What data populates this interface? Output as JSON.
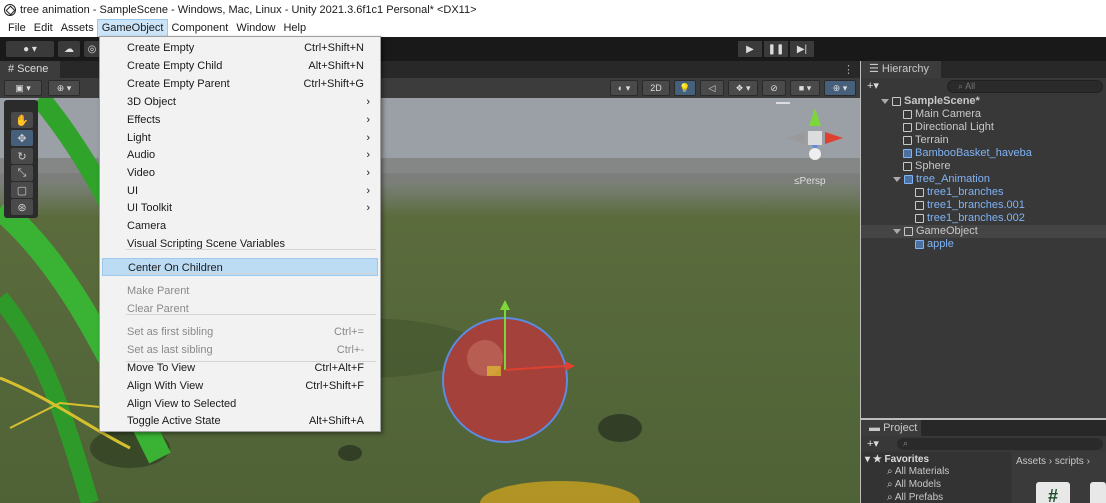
{
  "window": {
    "title": "tree animation - SampleScene - Windows, Mac, Linux - Unity 2021.3.6f1c1 Personal* <DX11>"
  },
  "menubar": [
    "File",
    "Edit",
    "Assets",
    "GameObject",
    "Component",
    "Window",
    "Help"
  ],
  "toolbar": {
    "play": "▶",
    "pause": "❚❚",
    "step": "▶|",
    "account": "☁"
  },
  "scene": {
    "tab_label": "# Scene",
    "persp_label": "≤Persp",
    "mode_2d": "2D"
  },
  "gameobject_menu": {
    "items": [
      {
        "label": "Create Empty",
        "shortcut": "Ctrl+Shift+N",
        "submenu": false,
        "disabled": false
      },
      {
        "label": "Create Empty Child",
        "shortcut": "Alt+Shift+N",
        "submenu": false,
        "disabled": false
      },
      {
        "label": "Create Empty Parent",
        "shortcut": "Ctrl+Shift+G",
        "submenu": false,
        "disabled": false
      },
      {
        "label": "3D Object",
        "shortcut": "",
        "submenu": true,
        "disabled": false
      },
      {
        "label": "Effects",
        "shortcut": "",
        "submenu": true,
        "disabled": false
      },
      {
        "label": "Light",
        "shortcut": "",
        "submenu": true,
        "disabled": false
      },
      {
        "label": "Audio",
        "shortcut": "",
        "submenu": true,
        "disabled": false
      },
      {
        "label": "Video",
        "shortcut": "",
        "submenu": true,
        "disabled": false
      },
      {
        "label": "UI",
        "shortcut": "",
        "submenu": true,
        "disabled": false
      },
      {
        "label": "UI Toolkit",
        "shortcut": "",
        "submenu": true,
        "disabled": false
      },
      {
        "label": "Camera",
        "shortcut": "",
        "submenu": false,
        "disabled": false
      },
      {
        "label": "Visual Scripting Scene Variables",
        "shortcut": "",
        "submenu": false,
        "disabled": false
      },
      {
        "label": "Center On Children",
        "shortcut": "",
        "submenu": false,
        "disabled": false,
        "highlighted": true
      },
      {
        "label": "Make Parent",
        "shortcut": "",
        "submenu": false,
        "disabled": true
      },
      {
        "label": "Clear Parent",
        "shortcut": "",
        "submenu": false,
        "disabled": true
      },
      {
        "label": "Set as first sibling",
        "shortcut": "Ctrl+=",
        "submenu": false,
        "disabled": true
      },
      {
        "label": "Set as last sibling",
        "shortcut": "Ctrl+-",
        "submenu": false,
        "disabled": true
      },
      {
        "label": "Move To View",
        "shortcut": "Ctrl+Alt+F",
        "submenu": false,
        "disabled": false
      },
      {
        "label": "Align With View",
        "shortcut": "Ctrl+Shift+F",
        "submenu": false,
        "disabled": false
      },
      {
        "label": "Align View to Selected",
        "shortcut": "",
        "submenu": false,
        "disabled": false
      },
      {
        "label": "Toggle Active State",
        "shortcut": "Alt+Shift+A",
        "submenu": false,
        "disabled": false
      }
    ],
    "arrow_glyph": "›"
  },
  "hierarchy": {
    "tab_label": "Hierarchy",
    "add_label": "+▾",
    "search_placeholder": "All",
    "rows": [
      {
        "label": "SampleScene*",
        "depth": 0,
        "expander": true,
        "icon": "unity-scene-icon",
        "blue": false
      },
      {
        "label": "Main Camera",
        "depth": 1,
        "expander": false,
        "icon": "gameobject-icon",
        "blue": false
      },
      {
        "label": "Directional Light",
        "depth": 1,
        "expander": false,
        "icon": "gameobject-icon",
        "blue": false
      },
      {
        "label": "Terrain",
        "depth": 1,
        "expander": false,
        "icon": "gameobject-icon",
        "blue": false
      },
      {
        "label": "BambooBasket_haveba",
        "depth": 1,
        "expander": false,
        "icon": "prefab-icon",
        "blue": true
      },
      {
        "label": "Sphere",
        "depth": 1,
        "expander": false,
        "icon": "gameobject-icon",
        "blue": false
      },
      {
        "label": "tree_Animation",
        "depth": 1,
        "expander": true,
        "icon": "prefab-icon",
        "blue": true
      },
      {
        "label": "tree1_branches",
        "depth": 2,
        "expander": false,
        "icon": "gameobject-icon",
        "blue": true
      },
      {
        "label": "tree1_branches.001",
        "depth": 2,
        "expander": false,
        "icon": "gameobject-icon",
        "blue": true
      },
      {
        "label": "tree1_branches.002",
        "depth": 2,
        "expander": false,
        "icon": "gameobject-icon",
        "blue": true
      },
      {
        "label": "GameObject",
        "depth": 1,
        "expander": true,
        "icon": "gameobject-icon",
        "blue": false,
        "highlighted": true
      },
      {
        "label": "apple",
        "depth": 2,
        "expander": false,
        "icon": "prefab-icon",
        "blue": true
      }
    ]
  },
  "project": {
    "tab_label": "Project",
    "add_label": "+▾",
    "favorites_label": "★ Favorites",
    "favorites": [
      "All Materials",
      "All Models",
      "All Prefabs"
    ],
    "breadcrumb": "Assets › scripts ›",
    "script_icon_glyph": "#"
  }
}
